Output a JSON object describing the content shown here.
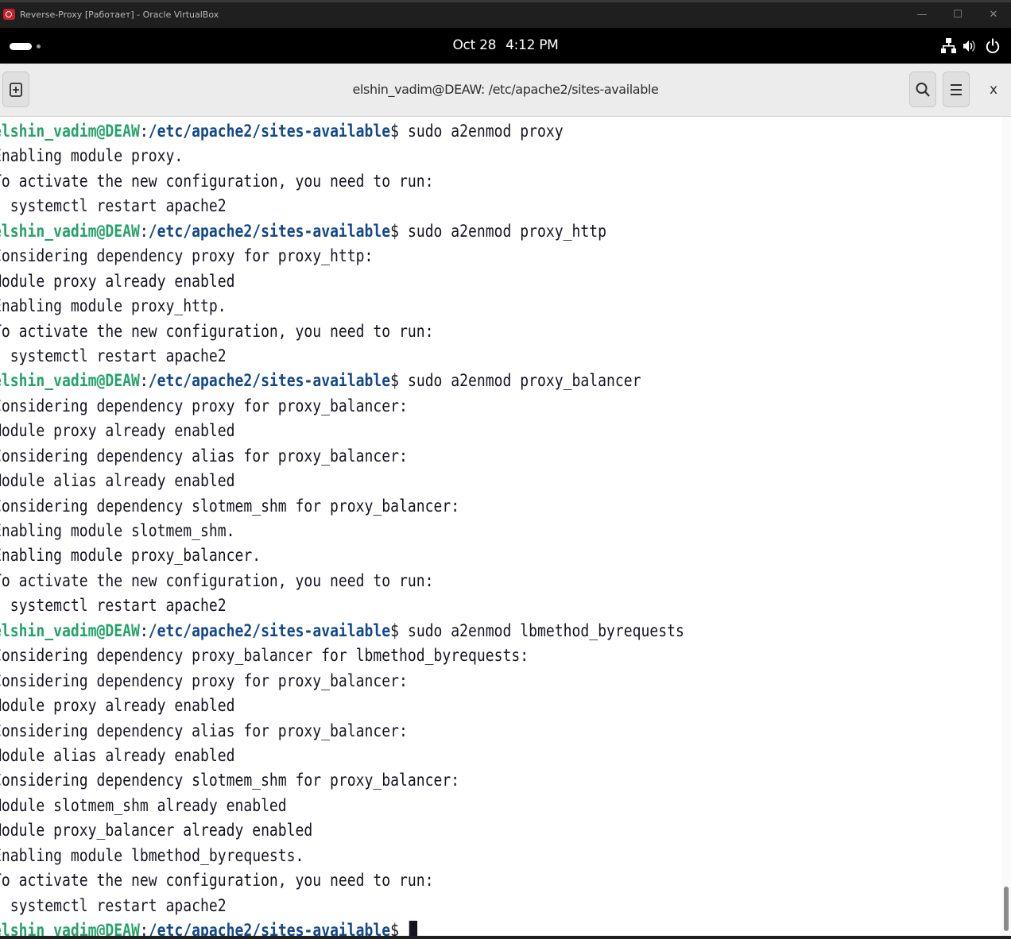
{
  "host_window": {
    "title": "Reverse-Proxy [Работает] - Oracle VirtualBox",
    "minimize_label": "—",
    "maximize_label": "☐",
    "close_label": "✕"
  },
  "gnome_bar": {
    "date": "Oct 28",
    "time": "4:12 PM",
    "icons": [
      "network-icon",
      "volume-icon",
      "power-icon"
    ]
  },
  "terminal": {
    "title": "elshin_vadim@DEAW: /etc/apache2/sites-available",
    "close_label": "x",
    "prompt_user": "elshin_vadim@DEAW",
    "prompt_path": "/etc/apache2/sites-available",
    "lines": [
      {
        "type": "prompt",
        "cmd": " sudo a2enmod proxy"
      },
      {
        "type": "out",
        "text": "Enabling module proxy."
      },
      {
        "type": "out",
        "text": "To activate the new configuration, you need to run:"
      },
      {
        "type": "out",
        "text": "  systemctl restart apache2"
      },
      {
        "type": "prompt",
        "cmd": " sudo a2enmod proxy_http"
      },
      {
        "type": "out",
        "text": "Considering dependency proxy for proxy_http:"
      },
      {
        "type": "out",
        "text": "Module proxy already enabled"
      },
      {
        "type": "out",
        "text": "Enabling module proxy_http."
      },
      {
        "type": "out",
        "text": "To activate the new configuration, you need to run:"
      },
      {
        "type": "out",
        "text": "  systemctl restart apache2"
      },
      {
        "type": "prompt",
        "cmd": " sudo a2enmod proxy_balancer"
      },
      {
        "type": "out",
        "text": "Considering dependency proxy for proxy_balancer:"
      },
      {
        "type": "out",
        "text": "Module proxy already enabled"
      },
      {
        "type": "out",
        "text": "Considering dependency alias for proxy_balancer:"
      },
      {
        "type": "out",
        "text": "Module alias already enabled"
      },
      {
        "type": "out",
        "text": "Considering dependency slotmem_shm for proxy_balancer:"
      },
      {
        "type": "out",
        "text": "Enabling module slotmem_shm."
      },
      {
        "type": "out",
        "text": "Enabling module proxy_balancer."
      },
      {
        "type": "out",
        "text": "To activate the new configuration, you need to run:"
      },
      {
        "type": "out",
        "text": "  systemctl restart apache2"
      },
      {
        "type": "prompt",
        "cmd": " sudo a2enmod lbmethod_byrequests"
      },
      {
        "type": "out",
        "text": "Considering dependency proxy_balancer for lbmethod_byrequests:"
      },
      {
        "type": "out",
        "text": "Considering dependency proxy for proxy_balancer:"
      },
      {
        "type": "out",
        "text": "Module proxy already enabled"
      },
      {
        "type": "out",
        "text": "Considering dependency alias for proxy_balancer:"
      },
      {
        "type": "out",
        "text": "Module alias already enabled"
      },
      {
        "type": "out",
        "text": "Considering dependency slotmem_shm for proxy_balancer:"
      },
      {
        "type": "out",
        "text": "Module slotmem_shm already enabled"
      },
      {
        "type": "out",
        "text": "Module proxy_balancer already enabled"
      },
      {
        "type": "out",
        "text": "Enabling module lbmethod_byrequests."
      },
      {
        "type": "out",
        "text": "To activate the new configuration, you need to run:"
      },
      {
        "type": "out",
        "text": "  systemctl restart apache2"
      },
      {
        "type": "prompt",
        "cmd": " ",
        "cursor": true
      }
    ]
  },
  "colors": {
    "prompt_user": "#26a269",
    "prompt_path": "#12488b",
    "text": "#171421"
  }
}
